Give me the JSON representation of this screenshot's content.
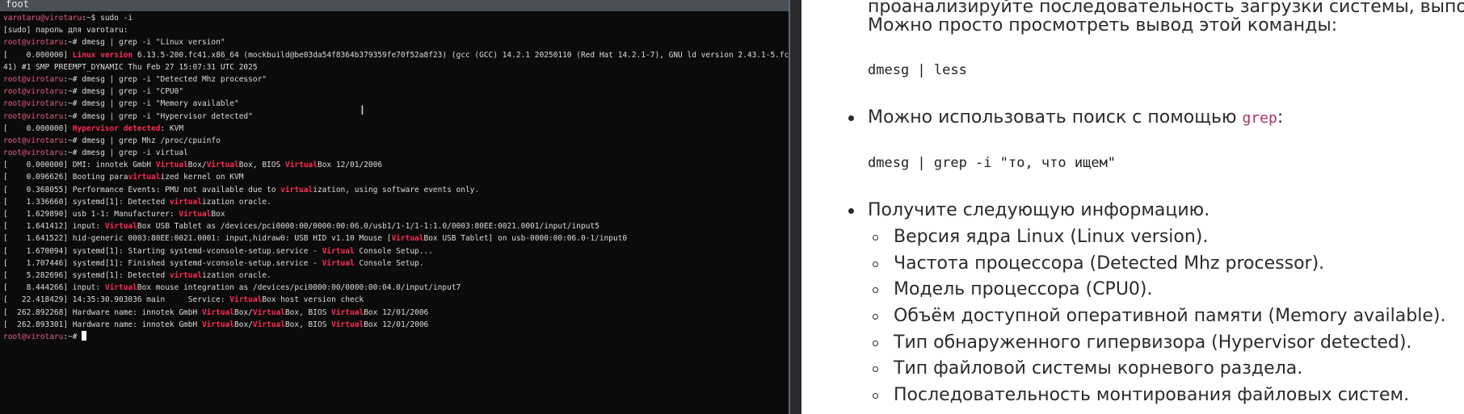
{
  "terminal": {
    "title": "foot",
    "lines": [
      [
        {
          "t": "varotaru@virotaru",
          "c": "prompt"
        },
        {
          "t": ":~$ sudo -i"
        }
      ],
      [
        {
          "t": "[sudo] пароль для varotaru:"
        }
      ],
      [
        {
          "t": "root@virotaru",
          "c": "prompt"
        },
        {
          "t": ":~# dmesg | grep -i \"Linux version\""
        }
      ],
      [
        {
          "t": "[    0.000000] "
        },
        {
          "t": "Linux version",
          "c": "hl"
        },
        {
          "t": " 6.13.5-200.fc41.x86_64 (mockbuild@be03da54f8364b379359fe70f52a8f23) (gcc (GCC) 14.2.1 20250110 (Red Hat 14.2.1-7), GNU ld version 2.43.1-5.fc"
        }
      ],
      [
        {
          "t": "41) #1 SMP PREEMPT_DYNAMIC Thu Feb 27 15:07:31 UTC 2025"
        }
      ],
      [
        {
          "t": "root@virotaru",
          "c": "prompt"
        },
        {
          "t": ":~# dmesg | grep -i \"Detected Mhz processor\""
        }
      ],
      [
        {
          "t": "root@virotaru",
          "c": "prompt"
        },
        {
          "t": ":~# dmesg | grep -i \"CPU0\""
        }
      ],
      [
        {
          "t": "root@virotaru",
          "c": "prompt"
        },
        {
          "t": ":~# dmesg | grep -i \"Memory available\""
        }
      ],
      [
        {
          "t": "root@virotaru",
          "c": "prompt"
        },
        {
          "t": ":~# dmesg | grep -i \"Hypervisor detected\""
        }
      ],
      [
        {
          "t": "[    0.000000] "
        },
        {
          "t": "Hypervisor detected",
          "c": "hl"
        },
        {
          "t": ": KVM"
        }
      ],
      [
        {
          "t": "root@virotaru",
          "c": "prompt"
        },
        {
          "t": ":~# dmesg | grep Mhz /proc/cpuinfo"
        }
      ],
      [
        {
          "t": "root@virotaru",
          "c": "prompt"
        },
        {
          "t": ":~# dmesg | grep -i virtual"
        }
      ],
      [
        {
          "t": "[    0.000000] DMI: innotek GmbH "
        },
        {
          "t": "Virtual",
          "c": "hl"
        },
        {
          "t": "Box/"
        },
        {
          "t": "Virtual",
          "c": "hl"
        },
        {
          "t": "Box, BIOS "
        },
        {
          "t": "Virtual",
          "c": "hl"
        },
        {
          "t": "Box 12/01/2006"
        }
      ],
      [
        {
          "t": "[    0.096626] Booting para"
        },
        {
          "t": "virtual",
          "c": "hl"
        },
        {
          "t": "ized kernel on KVM"
        }
      ],
      [
        {
          "t": "[    0.368055] Performance Events: PMU not available due to "
        },
        {
          "t": "virtual",
          "c": "hl"
        },
        {
          "t": "ization, using software events only."
        }
      ],
      [
        {
          "t": "[    1.336660] systemd[1]: Detected "
        },
        {
          "t": "virtual",
          "c": "hl"
        },
        {
          "t": "ization oracle."
        }
      ],
      [
        {
          "t": "[    1.629890] usb 1-1: Manufacturer: "
        },
        {
          "t": "Virtual",
          "c": "hl"
        },
        {
          "t": "Box"
        }
      ],
      [
        {
          "t": "[    1.641412] input: "
        },
        {
          "t": "Virtual",
          "c": "hl"
        },
        {
          "t": "Box USB Tablet as /devices/pci0000:00/0000:00:06.0/usb1/1-1/1-1:1.0/0003:80EE:0021.0001/input/input5"
        }
      ],
      [
        {
          "t": "[    1.641522] hid-generic 0003:80EE:0021.0001: input,hidraw0: USB HID v1.10 Mouse ["
        },
        {
          "t": "Virtual",
          "c": "hl"
        },
        {
          "t": "Box USB Tablet] on usb-0000:00:06.0-1/input0"
        }
      ],
      [
        {
          "t": "[    1.670094] systemd[1]: Starting systemd-vconsole-setup.service - "
        },
        {
          "t": "Virtual",
          "c": "hl"
        },
        {
          "t": " Console Setup..."
        }
      ],
      [
        {
          "t": "[    1.707446] systemd[1]: Finished systemd-vconsole-setup.service - "
        },
        {
          "t": "Virtual",
          "c": "hl"
        },
        {
          "t": " Console Setup."
        }
      ],
      [
        {
          "t": "[    5.282696] systemd[1]: Detected "
        },
        {
          "t": "virtual",
          "c": "hl"
        },
        {
          "t": "ization oracle."
        }
      ],
      [
        {
          "t": "[    8.444266] input: "
        },
        {
          "t": "Virtual",
          "c": "hl"
        },
        {
          "t": "Box mouse integration as /devices/pci0000:00/0000:00:04.0/input/input7"
        }
      ],
      [
        {
          "t": "[   22.418429] 14:35:30.903036 main     Service: "
        },
        {
          "t": "Virtual",
          "c": "hl"
        },
        {
          "t": "Box host version check"
        }
      ],
      [
        {
          "t": "[  262.892268] Hardware name: innotek GmbH "
        },
        {
          "t": "Virtual",
          "c": "hl"
        },
        {
          "t": "Box/"
        },
        {
          "t": "Virtual",
          "c": "hl"
        },
        {
          "t": "Box, BIOS "
        },
        {
          "t": "Virtual",
          "c": "hl"
        },
        {
          "t": "Box 12/01/2006"
        }
      ],
      [
        {
          "t": "[  262.893301] Hardware name: innotek GmbH "
        },
        {
          "t": "Virtual",
          "c": "hl"
        },
        {
          "t": "Box/"
        },
        {
          "t": "Virtual",
          "c": "hl"
        },
        {
          "t": "Box, BIOS "
        },
        {
          "t": "Virtual",
          "c": "hl"
        },
        {
          "t": "Box 12/01/2006"
        }
      ],
      [
        {
          "t": "root@virotaru",
          "c": "prompt"
        },
        {
          "t": ":~# "
        }
      ]
    ]
  },
  "doc": {
    "intro_line1": "проанализируйте последовательность загрузки системы, выпол",
    "intro_line2": "Можно просто просмотреть вывод этой команды:",
    "code1": "dmesg | less",
    "bullet1_text": "Можно использовать поиск с помощью ",
    "bullet1_code": "grep",
    "bullet1_tail": ":",
    "code2": "dmesg | grep -i \"то, что ищем\"",
    "bullet2_text": "Получите следующую информацию.",
    "sub_items": [
      "Версия ядра Linux (Linux version).",
      "Частота процессора (Detected Mhz processor).",
      "Модель процессора (CPU0).",
      "Объём доступной оперативной памяти (Memory available).",
      "Тип обнаруженного гипервизора (Hypervisor detected).",
      "Тип файловой системы корневого раздела.",
      "Последовательность монтирования файловых систем."
    ]
  }
}
